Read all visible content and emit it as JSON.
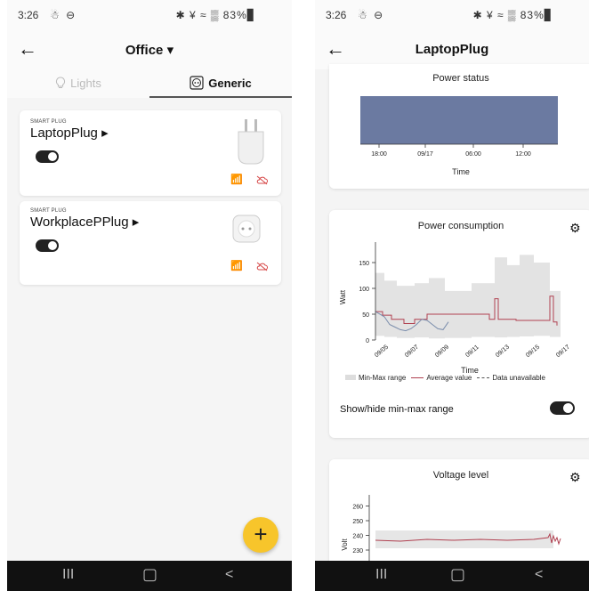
{
  "left_screen": {
    "status": {
      "time": "3:26",
      "left_icons": "☃ ⊖",
      "right_icons": "✱ ¥ ≈ ▒ 83%▊"
    },
    "title": "Office",
    "title_caret": "▾",
    "tabs": [
      {
        "label": "Lights",
        "icon": "bulb-icon"
      },
      {
        "label": "Generic",
        "icon": "socket-icon"
      }
    ],
    "devices": [
      {
        "type": "SMART PLUG",
        "name": "LaptopPlug ▸",
        "on": true
      },
      {
        "type": "SMART PLUG",
        "name": "WorkplacePPlug ▸",
        "on": true
      }
    ],
    "fab_label": "+",
    "nav": {
      "recent": "III",
      "home": "▢",
      "back": "<"
    }
  },
  "right_screen": {
    "status": {
      "time": "3:26",
      "left_icons": "☃ ⊖",
      "right_icons": "✱ ¥ ≈ ▒ 83%▊"
    },
    "title": "LaptopPlug",
    "power_status": {
      "title": "Power status",
      "xlabel": "Time",
      "ticks": [
        "18:00",
        "09/17",
        "06:00",
        "12:00"
      ],
      "color": "#6b7aa1"
    },
    "power_consumption": {
      "title": "Power consumption",
      "ylabel": "Watt",
      "xlabel": "Time",
      "yticks": [
        "0",
        "50",
        "100",
        "150"
      ],
      "xticks": [
        "09/05",
        "09/07",
        "09/09",
        "09/11",
        "09/13",
        "09/15",
        "09/17"
      ],
      "legend": {
        "range": "Min-Max range",
        "avg": "Average value",
        "na": "Data unavailable"
      },
      "toggle_label": "Show/hide min-max range",
      "avg_color": "#b04050"
    },
    "voltage": {
      "title": "Voltage level",
      "ylabel": "Volt",
      "yticks": [
        "230",
        "240",
        "250",
        "260"
      ]
    },
    "nav": {
      "recent": "III",
      "home": "▢",
      "back": "<"
    }
  }
}
